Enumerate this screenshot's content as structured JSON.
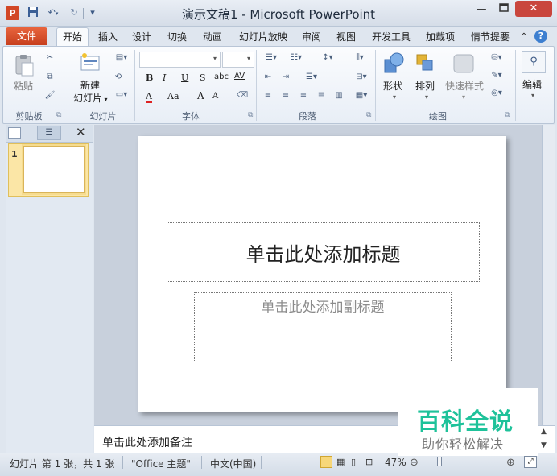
{
  "window": {
    "title": "演示文稿1 - Microsoft PowerPoint",
    "app_icon": "P"
  },
  "quick_access": {
    "save_icon": "save-icon",
    "undo_icon": "undo-icon",
    "redo_icon": "redo-icon"
  },
  "tabs": {
    "file": "文件",
    "home": "开始",
    "insert": "插入",
    "design": "设计",
    "transitions": "切换",
    "animations": "动画",
    "slideshow": "幻灯片放映",
    "review": "审阅",
    "view": "视图",
    "developer": "开发工具",
    "addins": "加载项",
    "storyboard": "情节提要"
  },
  "ribbon": {
    "clipboard": {
      "paste": "粘贴",
      "label": "剪贴板"
    },
    "slides": {
      "new_slide_line1": "新建",
      "new_slide_line2": "幻灯片",
      "label": "幻灯片"
    },
    "font": {
      "bold": "B",
      "italic": "I",
      "underline": "U",
      "strike": "S",
      "abc": "abc",
      "av": "AV",
      "font_color": "A",
      "case": "Aa",
      "grow": "A",
      "shrink": "A",
      "label": "字体"
    },
    "paragraph": {
      "label": "段落"
    },
    "drawing": {
      "shapes": "形状",
      "arrange": "排列",
      "quick_styles": "快速样式",
      "label": "绘图"
    },
    "editing": {
      "label": "编辑"
    }
  },
  "slide_pane": {
    "thumb_number": "1"
  },
  "slide": {
    "title_placeholder": "单击此处添加标题",
    "subtitle_placeholder": "单击此处添加副标题"
  },
  "notes": {
    "placeholder": "单击此处添加备注"
  },
  "status": {
    "slide_info": "幻灯片 第 1 张，共 1 张",
    "theme": "\"Office 主题\"",
    "language": "中文(中国)",
    "zoom": "47%"
  },
  "watermark": {
    "logo": "百科全说",
    "subtitle": "助你轻松解决"
  },
  "colors": {
    "file_tab": "#d24726",
    "close_button": "#c9463d",
    "watermark_green": "#1ec29a"
  }
}
